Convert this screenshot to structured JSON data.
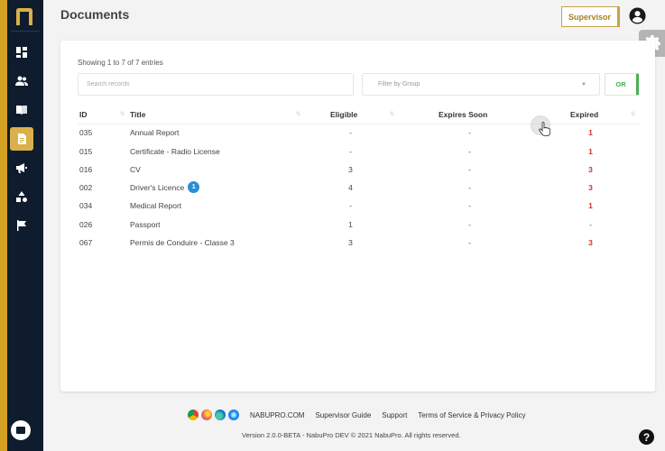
{
  "header": {
    "title": "Documents",
    "supervisor_label": "Supervisor"
  },
  "sidebar": {
    "items": [
      {
        "name": "dashboard-icon",
        "active": false
      },
      {
        "name": "users-icon",
        "active": false
      },
      {
        "name": "book-icon",
        "active": false
      },
      {
        "name": "document-icon",
        "active": true
      },
      {
        "name": "megaphone-icon",
        "active": false
      },
      {
        "name": "shapes-icon",
        "active": false
      },
      {
        "name": "flag-icon",
        "active": false
      }
    ]
  },
  "table": {
    "showing": "Showing 1 to 7 of 7 entries",
    "search_placeholder": "Search records",
    "filter_placeholder": "Filter by Group",
    "or_label": "OR",
    "columns": [
      "ID",
      "Title",
      "Eligible",
      "Expires Soon",
      "Expired"
    ],
    "rows": [
      {
        "id": "035",
        "title": "Annual Report",
        "badge": "",
        "eligible": "-",
        "expires_soon": "-",
        "expired": "1"
      },
      {
        "id": "015",
        "title": "Certificate - Radio License",
        "badge": "",
        "eligible": "-",
        "expires_soon": "-",
        "expired": "1"
      },
      {
        "id": "016",
        "title": "CV",
        "badge": "",
        "eligible": "3",
        "expires_soon": "-",
        "expired": "3"
      },
      {
        "id": "002",
        "title": "Driver's Licence",
        "badge": "1",
        "eligible": "4",
        "expires_soon": "-",
        "expired": "3"
      },
      {
        "id": "034",
        "title": "Medical Report",
        "badge": "",
        "eligible": "-",
        "expires_soon": "-",
        "expired": "1"
      },
      {
        "id": "026",
        "title": "Passport",
        "badge": "",
        "eligible": "1",
        "expires_soon": "-",
        "expired": "-"
      },
      {
        "id": "067",
        "title": "Permis de Conduire - Classe 3",
        "badge": "",
        "eligible": "3",
        "expires_soon": "-",
        "expired": "3"
      }
    ]
  },
  "footer": {
    "links": [
      "NABUPRO.COM",
      "Supervisor Guide",
      "Support",
      "Terms of Service & Privacy Policy"
    ],
    "version": "Version 2.0.0-BETA - NabuPro DEV © 2021 NabuPro. All rights reserved."
  },
  "colors": {
    "sidebar_bg": "#0f1c2e",
    "accent_gold": "#d9b04a",
    "expired_red": "#d32f2f",
    "or_green": "#4caf50",
    "badge_blue": "#2a8fd6"
  }
}
